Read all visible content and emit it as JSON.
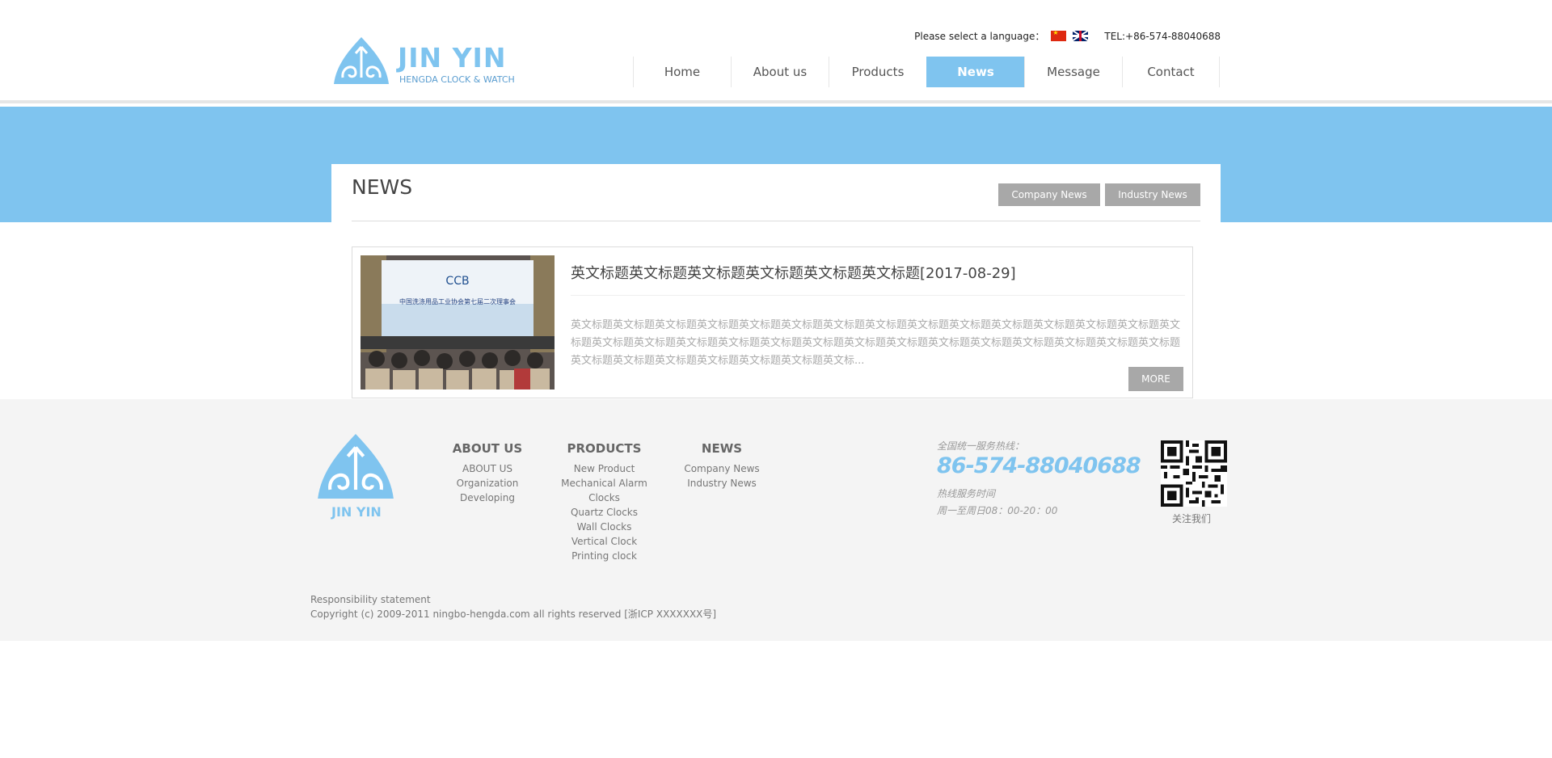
{
  "header": {
    "logo": {
      "name": "JIN YIN",
      "subtitle": "HENGDA CLOCK & WATCH"
    },
    "language_prompt": "Please select a language：",
    "languages": [
      "Chinese",
      "English"
    ],
    "tel": "TEL:+86-574-88040688"
  },
  "nav": {
    "items": [
      {
        "label": "Home"
      },
      {
        "label": "About us"
      },
      {
        "label": "Products"
      },
      {
        "label": "News",
        "active": true
      },
      {
        "label": "Message"
      },
      {
        "label": "Contact"
      }
    ]
  },
  "main": {
    "title": "NEWS",
    "sub_buttons": {
      "company": "Company News",
      "industry": "Industry News"
    },
    "news": [
      {
        "title": "英文标题英文标题英文标题英文标题英文标题英文标题[2017-08-29]",
        "summary": "英文标题英文标题英文标题英文标题英文标题英文标题英文标题英文标题英文标题英文标题英文标题英文标题英文标题英文标题英文标题英文标题英文标题英文标题英文标题英文标题英文标题英文标题英文标题英文标题英文标题英文标题英文标题英文标题英文标题英文标题英文标题英文标题英文标题英文标题英文标题英文标...",
        "more": "MORE",
        "image_caption": "中国洗涤用品工业协会第七届二次理事会"
      }
    ]
  },
  "footer": {
    "logo_name": "JIN YIN",
    "columns": {
      "about": {
        "heading": "ABOUT US",
        "links": [
          "ABOUT US",
          "Organization",
          "Developing"
        ]
      },
      "products": {
        "heading": "PRODUCTS",
        "links": [
          "New Product",
          "Mechanical Alarm Clocks",
          "Quartz Clocks",
          "Wall Clocks",
          "Vertical Clock",
          "Printing clock"
        ]
      },
      "news": {
        "heading": "NEWS",
        "links": [
          "Company News",
          "Industry News"
        ]
      }
    },
    "hotline": {
      "label": "全国统一服务热线：",
      "number": "86-574-88040688",
      "hours_label": "热线服务时间",
      "hours": "周一至周日08：00-20：00"
    },
    "qr_label": "关注我们",
    "legal": {
      "statement": "Responsibility statement",
      "copyright": "Copyright (c) 2009-2011 ningbo-hengda.com all rights reserved [浙ICP XXXXXXX号]"
    }
  },
  "colors": {
    "accent": "#7fc4ef",
    "button_gray": "#a8a8a8",
    "footer_bg": "#f4f4f4"
  }
}
